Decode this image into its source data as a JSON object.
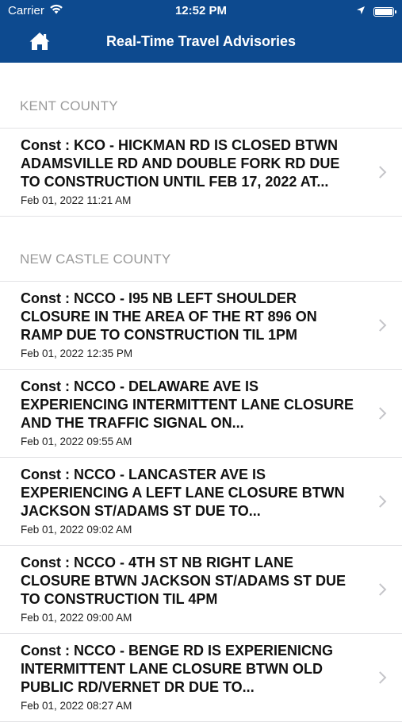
{
  "status_bar": {
    "carrier": "Carrier",
    "time": "12:52 PM"
  },
  "nav": {
    "title": "Real-Time Travel Advisories",
    "home_icon": "home-icon"
  },
  "colors": {
    "brand": "#0d4a8f",
    "section_header": "#9a9a9a"
  },
  "sections": [
    {
      "header": "KENT COUNTY",
      "items": [
        {
          "title": "Const : KCO - HICKMAN RD IS CLOSED BTWN ADAMSVILLE RD AND DOUBLE FORK RD DUE TO CONSTRUCTION UNTIL FEB 17, 2022 AT...",
          "date": "Feb 01, 2022 11:21 AM"
        }
      ]
    },
    {
      "header": "NEW CASTLE COUNTY",
      "items": [
        {
          "title": "Const : NCCO - I95 NB LEFT SHOULDER CLOSURE IN THE AREA OF THE RT 896 ON RAMP DUE TO CONSTRUCTION TIL 1PM",
          "date": "Feb 01, 2022 12:35 PM"
        },
        {
          "title": "Const : NCCO - DELAWARE AVE IS EXPERIENCING INTERMITTENT LANE CLOSURE AND THE TRAFFIC SIGNAL ON...",
          "date": "Feb 01, 2022 09:55 AM"
        },
        {
          "title": "Const : NCCO - LANCASTER AVE IS EXPERIENCING A LEFT LANE CLOSURE BTWN JACKSON ST/ADAMS ST DUE TO...",
          "date": "Feb 01, 2022 09:02 AM"
        },
        {
          "title": "Const : NCCO - 4TH ST NB RIGHT LANE CLOSURE BTWN JACKSON ST/ADAMS ST DUE TO CONSTRUCTION TIL 4PM",
          "date": "Feb 01, 2022 09:00 AM"
        },
        {
          "title": "Const : NCCO - BENGE RD IS EXPERIENICNG INTERMITTENT LANE CLOSURE BTWN OLD PUBLIC RD/VERNET DR DUE TO...",
          "date": "Feb 01, 2022 08:27 AM"
        }
      ]
    }
  ]
}
